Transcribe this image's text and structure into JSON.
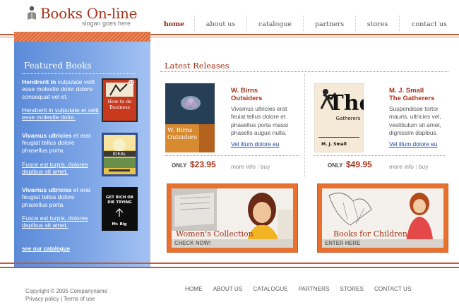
{
  "header": {
    "logo_title": "Books On-line",
    "slogan": "slogan goes here",
    "nav": [
      {
        "label": "home",
        "active": true
      },
      {
        "label": "about us",
        "active": false
      },
      {
        "label": "catalogue",
        "active": false
      },
      {
        "label": "partners",
        "active": false
      },
      {
        "label": "stores",
        "active": false
      },
      {
        "label": "contact us",
        "active": false
      }
    ]
  },
  "sidebar": {
    "title": "Featured Books",
    "items": [
      {
        "bold": "Hendrerit in",
        "text": " vulputate velit esse molestie dolor dolore consequat vel et.",
        "link": "Hendrerit in vulputate et velit esse molestie dolor.",
        "cover_title": "How to do Business",
        "cover_badge": "23"
      },
      {
        "bold": "Vivamus ultricies",
        "text": " et erat feugiat tellus dolore phasellus porta.",
        "link": "Fusce est turpis, dolores dapibus sit amet.",
        "cover_title": "IDEAL"
      },
      {
        "bold": "Vivamus ultricies",
        "text": " et erat feugiat tellus dolore phasellus porta.",
        "link": "Fusce est turpis, dolores dapibus sit amet.",
        "cover_title": "GET RICH OR DIE TRYING",
        "cover_author": "Mr. Big"
      }
    ],
    "see_catalogue": "see our catalogue"
  },
  "main": {
    "title": "Latest Releases",
    "books": [
      {
        "author": "W. Birns",
        "title": "Outsiders",
        "desc": "Vivamus ultricies erat feuiat tellus dolore et phasellus porta massi phasells augue nulla.",
        "link": "Vel illum dolore eu",
        "only": "ONLY",
        "price": "$23.95",
        "more": "more info",
        "buy": "buy",
        "cover_text": "W. Birns Outsiders"
      },
      {
        "author": "M. J. Small",
        "title": "The Gatherers",
        "desc": "Suspendisse tortor mauris, ultricies vel, vestibulum sit amet, dignissim dapibus.",
        "link": "Vel illum dolore eu",
        "only": "ONLY",
        "price": "$49.95",
        "more": "more info",
        "buy": "buy",
        "cover_title": "The",
        "cover_sub": "Gatherers",
        "cover_author": "M. J. Small"
      }
    ],
    "banners": [
      {
        "label": "Women's Collection",
        "sub": "CHECK NOW!"
      },
      {
        "label": "Books for Children",
        "sub": "ENTER HERE"
      }
    ]
  },
  "footer": {
    "copyright": "Copyright © 2005 Companyname",
    "privacy": "Privacy policy",
    "sep": "|",
    "terms": "Terms of use",
    "links": [
      "HOME",
      "ABOUT US",
      "CATALOGUE",
      "PARTNERS",
      "STORES",
      "CONTACT US"
    ]
  },
  "colors": {
    "accent": "#a5321a",
    "sidebar": "#7ea6e6",
    "banner_frame": "#e8712f",
    "link": "#2045a8"
  }
}
